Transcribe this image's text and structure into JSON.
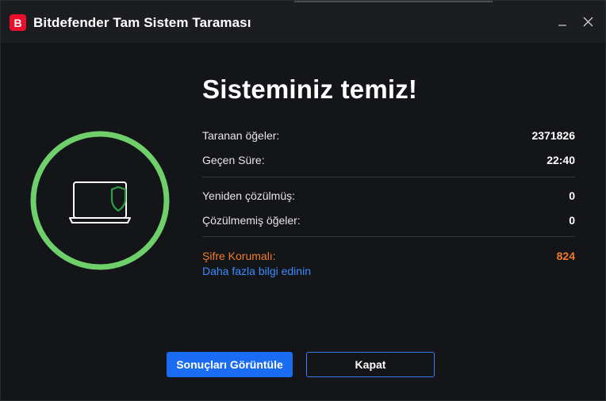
{
  "window": {
    "logo_letter": "B",
    "title": "Bitdefender Tam Sistem Taraması",
    "minimize_glyph": "—",
    "close_glyph": "✕"
  },
  "status": {
    "icon": "laptop-shield-icon",
    "ring_color": "#6fd06b",
    "headline": "Sisteminiz temiz!"
  },
  "stats": {
    "scanned_label": "Taranan öğeler:",
    "scanned_value": "2371826",
    "elapsed_label": "Geçen Süre:",
    "elapsed_value": "22:40",
    "resolved_label": "Yeniden çözülmüş:",
    "resolved_value": "0",
    "unresolved_label": "Çözülmemiş öğeler:",
    "unresolved_value": "0",
    "password_label": "Şifre Korumalı:",
    "password_value": "824",
    "learn_more": "Daha fazla bilgi edinin"
  },
  "actions": {
    "view_results": "Sonuçları Görüntüle",
    "close": "Kapat"
  },
  "colors": {
    "accent": "#1a6cf2",
    "warning": "#f07d2a",
    "link": "#3b8cff",
    "success": "#6fd06b"
  }
}
